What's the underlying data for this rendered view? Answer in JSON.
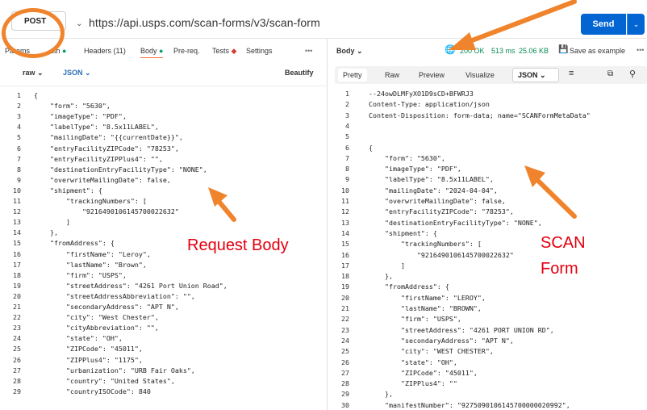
{
  "request": {
    "method": "POST",
    "url": "https://api.usps.com/scan-forms/v3/scan-form",
    "send_label": "Send"
  },
  "request_tabs": [
    {
      "label": "Params",
      "dot": ""
    },
    {
      "label": "uth",
      "dot": "green"
    },
    {
      "label": "Headers (11)",
      "dot": ""
    },
    {
      "label": "Body",
      "dot": "green"
    },
    {
      "label": "Pre-req.",
      "dot": ""
    },
    {
      "label": "Tests",
      "dot": "red"
    },
    {
      "label": "Settings",
      "dot": ""
    }
  ],
  "body_options": {
    "mode": "raw",
    "format": "JSON",
    "beautify": "Beautify"
  },
  "request_body_lines": [
    "{",
    "    \"form\": \"5630\",",
    "    \"imageType\": \"PDF\",",
    "    \"labelType\": \"8.5x11LABEL\",",
    "    \"mailingDate\": \"{{currentDate}}\",",
    "    \"entryFacilityZIPCode\": \"78253\",",
    "    \"entryFacilityZIPPlus4\": \"\",",
    "    \"destinationEntryFacilityType\": \"NONE\",",
    "    \"overwriteMailingDate\": false,",
    "    \"shipment\": {",
    "        \"trackingNumbers\": [",
    "            \"9216490106145700022632\"",
    "        ]",
    "    },",
    "    \"fromAddress\": {",
    "        \"firstName\": \"Leroy\",",
    "        \"lastName\": \"Brown\",",
    "        \"firm\": \"USPS\",",
    "        \"streetAddress\": \"4261 Port Union Road\",",
    "        \"streetAddressAbbreviation\": \"\",",
    "        \"secondaryAddress\": \"APT N\",",
    "        \"city\": \"West Chester\",",
    "        \"cityAbbreviation\": \"\",",
    "        \"state\": \"OH\",",
    "        \"ZIPCode\": \"45011\",",
    "        \"ZIPPlus4\": \"1175\",",
    "        \"urbanization\": \"URB Fair Oaks\",",
    "        \"country\": \"United States\",",
    "        \"countryISOCode\": 840"
  ],
  "response_header": {
    "body_label": "Body",
    "status": "200 OK",
    "time": "513 ms",
    "size": "25.06 KB",
    "save": "Save as example"
  },
  "response_tabs": [
    "Pretty",
    "Raw",
    "Preview",
    "Visualize"
  ],
  "response_format": "JSON",
  "response_lines": [
    "--24owDLMFyXO1D9sCD+BFWRJ3",
    "Content-Type: application/json",
    "Content-Disposition: form-data; name=\"SCANFormMetaData\"",
    "",
    "",
    "{",
    "    \"form\": \"5630\",",
    "    \"imageType\": \"PDF\",",
    "    \"labelType\": \"8.5x11LABEL\",",
    "    \"mailingDate\": \"2024-04-04\",",
    "    \"overwriteMailingDate\": false,",
    "    \"entryFacilityZIPCode\": \"78253\",",
    "    \"destinationEntryFacilityType\": \"NONE\",",
    "    \"shipment\": {",
    "        \"trackingNumbers\": [",
    "            \"9216490106145700022632\"",
    "        ]",
    "    },",
    "    \"fromAddress\": {",
    "        \"firstName\": \"LEROY\",",
    "        \"lastName\": \"BROWN\",",
    "        \"firm\": \"USPS\",",
    "        \"streetAddress\": \"4261 PORT UNION RD\",",
    "        \"secondaryAddress\": \"APT N\",",
    "        \"city\": \"WEST CHESTER\",",
    "        \"state\": \"OH\",",
    "        \"ZIPCode\": \"45011\",",
    "        \"ZIPPlus4\": \"\"",
    "    },",
    "    \"manifestNumber\": \"9275090106145700000020992\","
  ],
  "annotations": {
    "request_body": "Request Body",
    "scan_form_line1": "SCAN",
    "scan_form_line2": "Form"
  },
  "colors": {
    "accent": "#0265d2",
    "annotation": "#f0842c",
    "annotation_text": "#e3000f"
  }
}
